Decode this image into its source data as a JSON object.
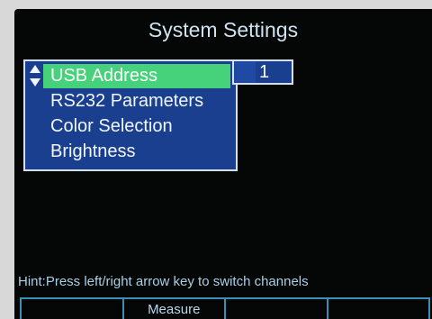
{
  "title": "System Settings",
  "menu": {
    "items": [
      {
        "label": "USB Address",
        "selected": true
      },
      {
        "label": "RS232 Parameters",
        "selected": false
      },
      {
        "label": "Color Selection",
        "selected": false
      },
      {
        "label": "Brightness",
        "selected": false
      }
    ]
  },
  "usb_address_value": "1",
  "hint": "Hint:Press left/right arrow key to switch channels",
  "softkeys": [
    "",
    "Measure",
    "",
    ""
  ],
  "icons": {
    "scroll": "up-down-arrows-icon"
  },
  "colors": {
    "background": "#050606",
    "menu_bg": "#1b3f8f",
    "selection": "#46d27a",
    "text": "#cfe3f0",
    "accent": "#3b8fb5"
  }
}
